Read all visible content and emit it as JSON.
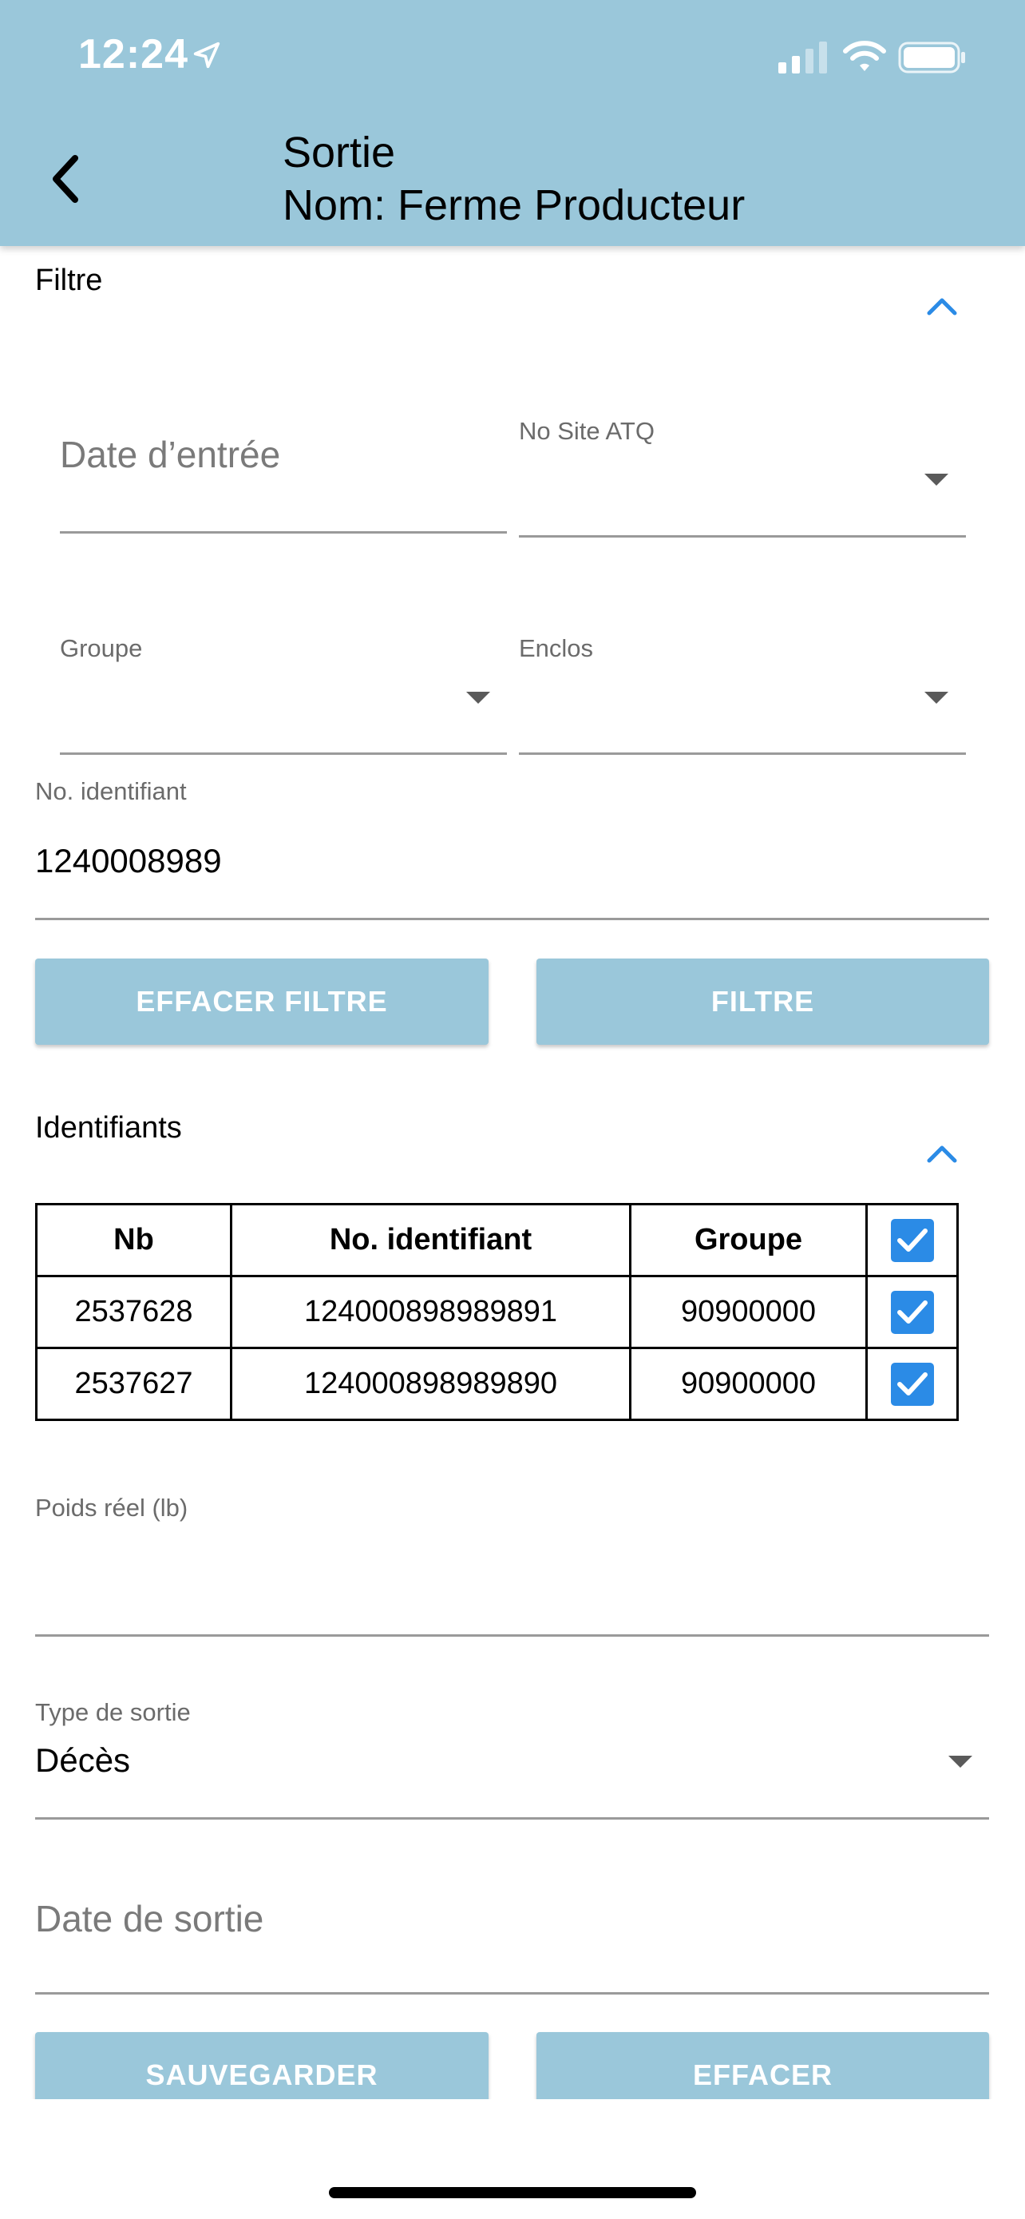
{
  "status_bar": {
    "time": "12:24"
  },
  "header": {
    "title": "Sortie",
    "subtitle": "Nom: Ferme Producteur"
  },
  "filter": {
    "section_label": "Filtre",
    "date_entree_placeholder": "Date d’entrée",
    "no_site_label": "No Site ATQ",
    "groupe_label": "Groupe",
    "enclos_label": "Enclos",
    "identifiant_label": "No. identifiant",
    "identifiant_value": "1240008989",
    "clear_button": "EFFACER FILTRE",
    "filter_button": "FILTRE"
  },
  "identifiants": {
    "section_label": "Identifiants",
    "columns": [
      "Nb",
      "No. identifiant",
      "Groupe"
    ],
    "rows": [
      {
        "nb": "2537628",
        "identifiant": "124000898989891",
        "groupe": "90900000",
        "checked": true
      },
      {
        "nb": "2537627",
        "identifiant": "124000898989890",
        "groupe": "90900000",
        "checked": true
      }
    ],
    "header_checked": true
  },
  "form": {
    "poids_label": "Poids réel (lb)",
    "type_label": "Type de sortie",
    "type_value": "Décès",
    "date_sortie_placeholder": "Date de sortie",
    "save_button": "SAUVEGARDER",
    "clear_button": "EFFACER"
  },
  "colors": {
    "header": "#9ac7da",
    "accent": "#2b8be6",
    "button": "#9ac7da"
  }
}
